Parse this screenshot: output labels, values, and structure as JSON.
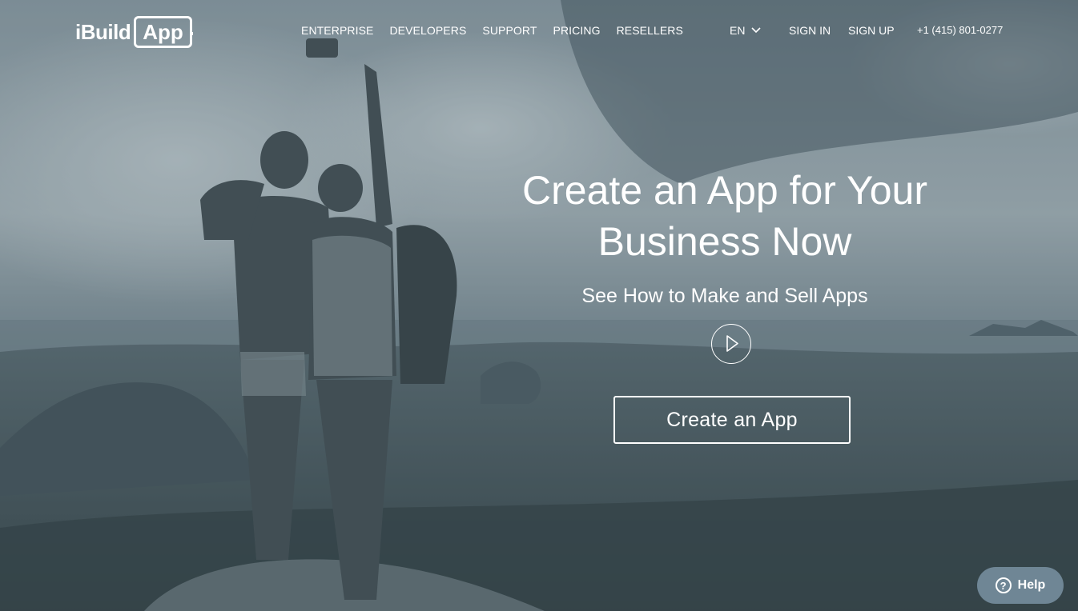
{
  "header": {
    "logo": {
      "prefix": "iBuild",
      "boxed": "App"
    },
    "nav": [
      {
        "label": "ENTERPRISE"
      },
      {
        "label": "DEVELOPERS"
      },
      {
        "label": "SUPPORT"
      },
      {
        "label": "PRICING"
      },
      {
        "label": "RESELLERS"
      }
    ],
    "language": {
      "selected": "EN",
      "icon": "chevron-down-icon"
    },
    "sign_in": "SIGN IN",
    "sign_up": "SIGN UP",
    "phone": "+1 (415) 801-0277"
  },
  "hero": {
    "title_line1": "Create an App for Your",
    "title_line2": "Business Now",
    "subtitle": "See How to Make and Sell Apps",
    "play_icon": "play-icon",
    "cta_label": "Create an App"
  },
  "help": {
    "label": "Help",
    "icon": "question-icon",
    "icon_glyph": "?"
  },
  "colors": {
    "overlay": "#5f6f78",
    "sky_light": "#b7c2c7",
    "help_bg": "#6f8695",
    "text": "#ffffff"
  }
}
